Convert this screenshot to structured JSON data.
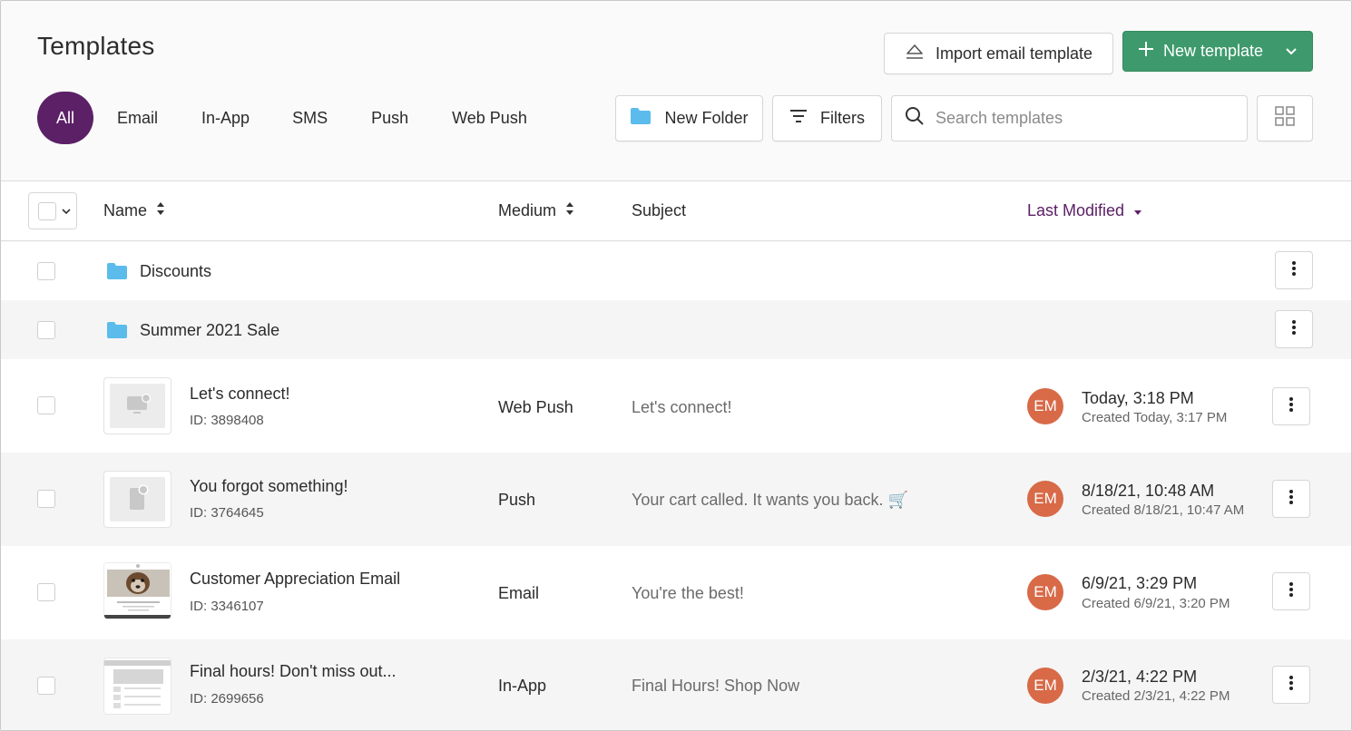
{
  "header": {
    "title": "Templates",
    "import_label": "Import email template",
    "new_template_label": "New template"
  },
  "tabs": [
    {
      "label": "All",
      "active": true
    },
    {
      "label": "Email"
    },
    {
      "label": "In-App"
    },
    {
      "label": "SMS"
    },
    {
      "label": "Push"
    },
    {
      "label": "Web Push"
    }
  ],
  "toolbar": {
    "new_folder_label": "New Folder",
    "filters_label": "Filters",
    "search_placeholder": "Search templates"
  },
  "table": {
    "columns": {
      "name": "Name",
      "medium": "Medium",
      "subject": "Subject",
      "last_modified": "Last Modified"
    },
    "folders": [
      {
        "name": "Discounts"
      },
      {
        "name": "Summer 2021 Sale"
      }
    ],
    "templates": [
      {
        "name": "Let's connect!",
        "id": "ID: 3898408",
        "medium": "Web Push",
        "subject": "Let's connect!",
        "avatar": "EM",
        "modified": "Today, 3:18 PM",
        "created": "Created Today, 3:17 PM",
        "thumb": "web-push-icon"
      },
      {
        "name": "You forgot something!",
        "id": "ID: 3764645",
        "medium": "Push",
        "subject": "Your cart called. It wants you back. 🛒",
        "avatar": "EM",
        "modified": "8/18/21, 10:48 AM",
        "created": "Created 8/18/21, 10:47 AM",
        "thumb": "push-icon"
      },
      {
        "name": "Customer Appreciation Email",
        "id": "ID: 3346107",
        "medium": "Email",
        "subject": "You're the best!",
        "avatar": "EM",
        "modified": "6/9/21, 3:29 PM",
        "created": "Created 6/9/21, 3:20 PM",
        "thumb": "email-preview"
      },
      {
        "name": "Final hours! Don't miss out...",
        "id": "ID: 2699656",
        "medium": "In-App",
        "subject": "Final Hours! Shop Now",
        "avatar": "EM",
        "modified": "2/3/21, 4:22 PM",
        "created": "Created 2/3/21, 4:22 PM",
        "thumb": "in-app-preview"
      }
    ]
  },
  "colors": {
    "accent_purple": "#5c2067",
    "primary_green": "#3e9a6c",
    "avatar_orange": "#d86a48",
    "folder_blue": "#5bbcec"
  }
}
